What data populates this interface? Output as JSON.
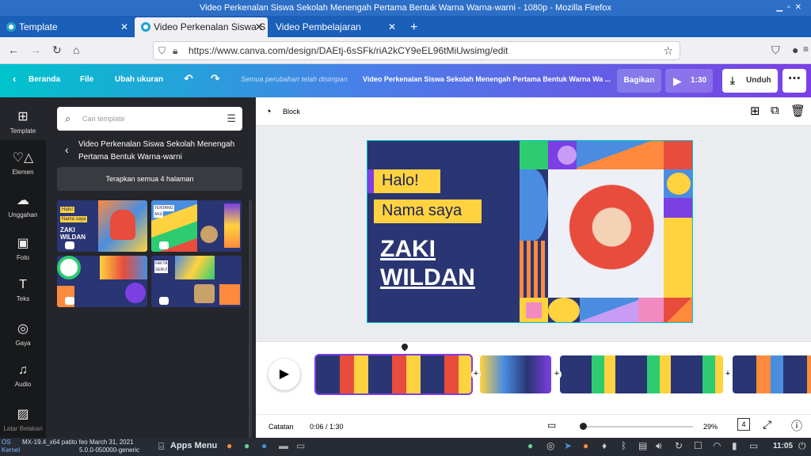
{
  "window_title": "Video Perkenalan Siswa Sekolah Menengah Pertama Bentuk Warna Warna-warni - 1080p - Mozilla Firefox",
  "tabs": [
    {
      "label": "Template"
    },
    {
      "label": "Video Perkenalan Siswa S"
    },
    {
      "label": "Video Pembelajaran"
    }
  ],
  "url": "https://www.canva.com/design/DAEtj-6sSFk/riA2kCY9eEL96tMiUwsimg/edit",
  "topbar": {
    "back_label": "Beranda",
    "file_label": "File",
    "resize_label": "Ubah ukuran",
    "saved_status": "Semua perubahan telah disimpan",
    "doc_title": "Video Perkenalan Siswa Sekolah Menengah Pertama Bentuk Warna Wa ...",
    "share_label": "Bagikan",
    "play_time": "1:30",
    "download_label": "Unduh"
  },
  "rail": [
    {
      "label": "Template",
      "icon": "template-icon"
    },
    {
      "label": "Elemen",
      "icon": "elements-icon"
    },
    {
      "label": "Unggahan",
      "icon": "upload-icon"
    },
    {
      "label": "Foto",
      "icon": "photo-icon"
    },
    {
      "label": "Teks",
      "icon": "text-icon"
    },
    {
      "label": "Gaya",
      "icon": "style-icon"
    },
    {
      "label": "Audio",
      "icon": "audio-icon"
    },
    {
      "label": "Latar Belakan",
      "icon": "background-icon"
    }
  ],
  "panel": {
    "search_placeholder": "Cari template",
    "template_title": "Video Perkenalan Siswa Sekolah Menengah Pertama Bentuk Warna-warni",
    "apply_label": "Terapkan semua 4 halaman"
  },
  "thumb_text": {
    "t1a": "Halo!",
    "t1b": "Nama saya",
    "t1c": "ZAKI",
    "t1d": "WILDAN",
    "t2a": "TENTANG",
    "t2b": "AKU",
    "t4a": "FAKTA",
    "t4b": "SERU!"
  },
  "toolbar": {
    "block_label": "Block"
  },
  "slide": {
    "greeting": "Halo!",
    "intro": "Nama saya",
    "first_name": "ZAKI",
    "last_name": "WILDAN"
  },
  "bottom": {
    "notes_label": "Catatan",
    "time": "0:06 / 1:30",
    "zoom": "29%",
    "page_count": "4"
  },
  "taskbar": {
    "os_line1": "MX-19.4_x64 patito feo March 31, 2021",
    "os_line2": "5.0.0-050000-generic",
    "apps_menu": "Apps Menu",
    "os_label1": "OS",
    "os_label2": "Kernel",
    "clock": "11:05"
  },
  "colors": {
    "accent": "#7b3fe4",
    "slide_bg": "#2a3574",
    "yellow": "#ffd23f"
  }
}
